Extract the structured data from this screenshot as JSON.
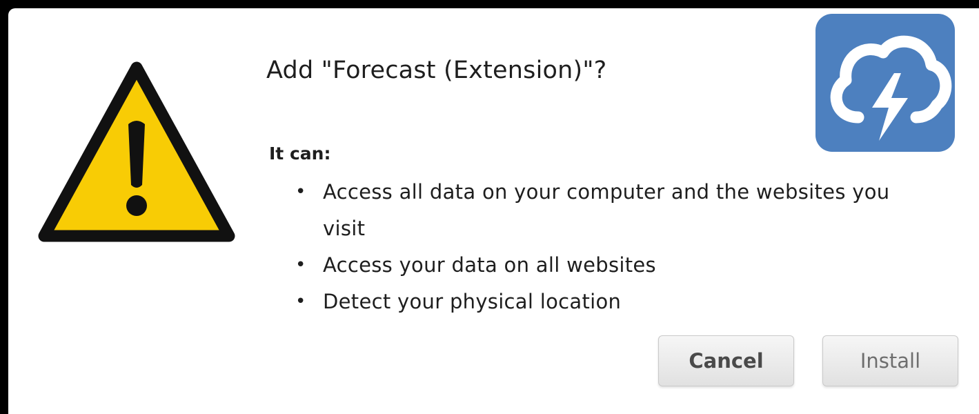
{
  "dialog": {
    "title": "Add \"Forecast (Extension)\"?",
    "subheading": "It can:",
    "permissions": [
      "Access all data on your computer and the websites you visit",
      "Access your data on all websites",
      "Detect your physical location"
    ],
    "bullet": "•",
    "buttons": {
      "cancel_label": "Cancel",
      "install_label": "Install"
    }
  },
  "icons": {
    "warning": "warning-triangle-icon",
    "app": "cloud-lightning-icon"
  },
  "colors": {
    "warning_fill": "#f8cc05",
    "app_icon_bg": "#4d80bf",
    "window_border": "#000000"
  }
}
